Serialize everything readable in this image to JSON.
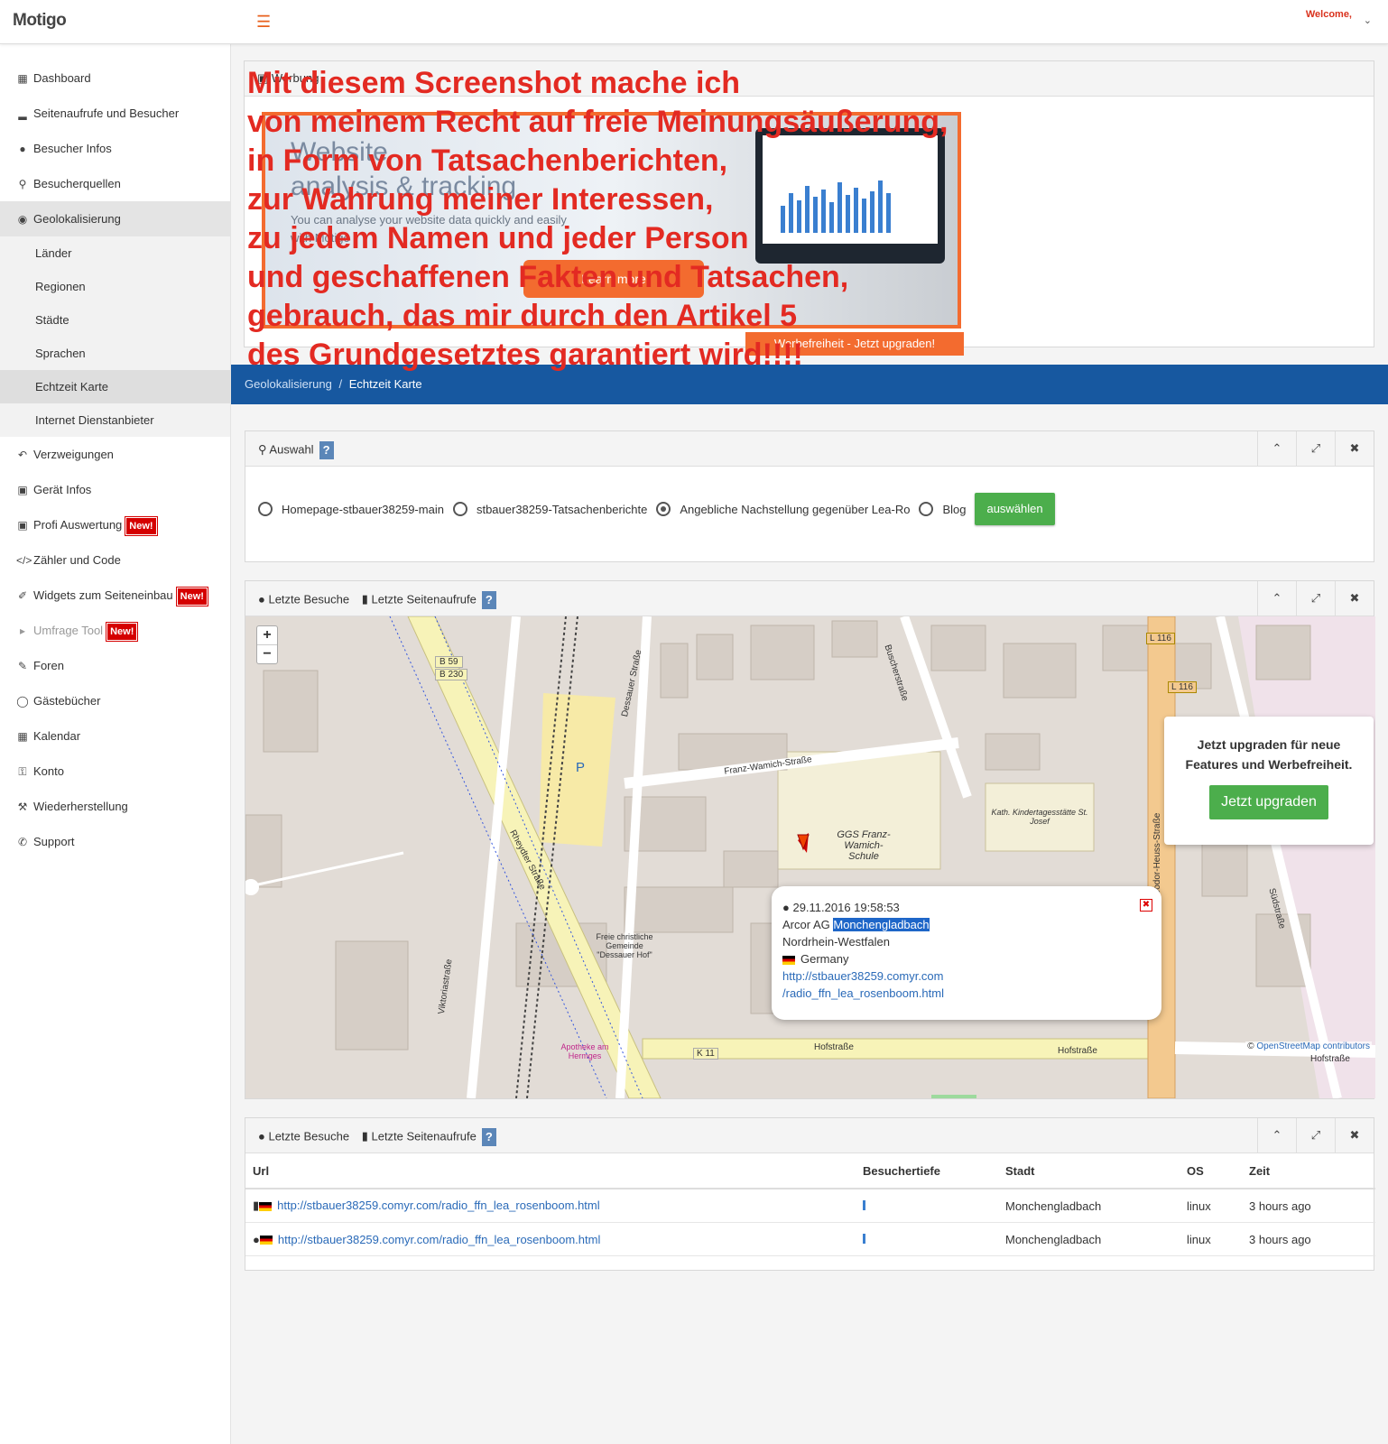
{
  "header": {
    "logo": "Motigo",
    "welcome": "Welcome,"
  },
  "sidebar": {
    "items": [
      {
        "label": "Dashboard",
        "icon": "table-icon"
      },
      {
        "label": "Seitenaufrufe und Besucher",
        "icon": "bar-chart-icon"
      },
      {
        "label": "Besucher Infos",
        "icon": "user-icon"
      },
      {
        "label": "Besucherquellen",
        "icon": "plug-icon"
      },
      {
        "label": "Geolokalisierung",
        "icon": "globe-icon"
      },
      {
        "label": "Länder"
      },
      {
        "label": "Regionen"
      },
      {
        "label": "Städte"
      },
      {
        "label": "Sprachen"
      },
      {
        "label": "Echtzeit Karte"
      },
      {
        "label": "Internet Dienstanbieter"
      },
      {
        "label": "Verzweigungen",
        "icon": "reply-icon"
      },
      {
        "label": "Gerät Infos",
        "icon": "desktop-icon"
      },
      {
        "label": "Profi Auswertung",
        "icon": "desktop-icon",
        "badge": "New!"
      },
      {
        "label": "Zähler und Code",
        "icon": "code-icon"
      },
      {
        "label": "Widgets zum Seiteneinbau",
        "icon": "paperclip-icon",
        "badge": "New!"
      },
      {
        "label": "Umfrage Tool",
        "icon": "bullhorn-icon",
        "badge": "New!"
      },
      {
        "label": "Foren",
        "icon": "edit-icon"
      },
      {
        "label": "Gästebücher",
        "icon": "comment-icon"
      },
      {
        "label": "Kalendar",
        "icon": "calendar-icon"
      },
      {
        "label": "Konto",
        "icon": "key-icon"
      },
      {
        "label": "Wiederherstellung",
        "icon": "wrench-icon"
      },
      {
        "label": "Support",
        "icon": "phone-icon"
      }
    ]
  },
  "ad": {
    "panel_title": "Werbung",
    "headline1": "Website",
    "headline2": "analysis & tracking",
    "text": "You can analyse your website data quickly and easily with Motigo",
    "button": "Learn more",
    "strip": "Werbefreiheit - Jetzt upgraden!"
  },
  "overlay_text": "Mit diesem Screenshot mache ich\nvon meinem Recht auf freie Meinungsäußerung,\nin Form von Tatsachenberichten,\nzur Wahrung meiner Interessen,\nzu jedem Namen und jeder Person\nund geschaffenen Fakten und Tatsachen,\ngebrauch, das mir durch den Artikel 5\ndes Grundgesetztes garantiert wird!!!!",
  "breadcrumb": {
    "parent": "Geolokalisierung",
    "separator": "/",
    "current": "Echtzeit Karte"
  },
  "auswahl": {
    "title": "Auswahl",
    "help": "?",
    "options": [
      {
        "label": "Homepage-stbauer38259-main",
        "checked": false
      },
      {
        "label": "stbauer38259-Tatsachenberichte",
        "checked": false
      },
      {
        "label": "Angebliche Nachstellung gegenüber Lea-Ro",
        "checked": true
      },
      {
        "label": "Blog",
        "checked": false
      }
    ],
    "button": "auswählen"
  },
  "map_panel": {
    "tab1": "Letzte Besuche",
    "tab2": "Letzte Seitenaufrufe",
    "help": "?",
    "popup": {
      "datetime": "29.11.2016 19:58:53",
      "isp": "Arcor AG",
      "city": "Monchengladbach",
      "region": "Nordrhein-Westfalen",
      "country": "Germany",
      "url_line1": "http://stbauer38259.comyr.com",
      "url_line2": "/radio_ffn_lea_rosenboom.html"
    },
    "upgrade": {
      "text": "Jetzt upgraden für neue Features und Werbefreiheit.",
      "button": "Jetzt upgraden"
    },
    "attribution_link": "OpenStreetMap",
    "attribution_rest": " contributors",
    "labels": {
      "b59": "B 59",
      "b230": "B 230",
      "dessauer": "Dessauer Straße",
      "franz": "Franz-Wamich-Straße",
      "rheydter": "Rheydter Straße",
      "buscher": "Buscherstraße",
      "school": "GGS Franz-Wamich-Schule",
      "kita": "Kath. Kindertagesstätte St. Josef",
      "church": "Freie christliche Gemeinde \"Dessauer Hof\"",
      "apotheke": "Apotheke am Hermges",
      "hofstrasse": "Hofstraße",
      "k11": "K 11",
      "l116": "L 116",
      "viktoria": "Viktoriastraße",
      "sued": "Südstraße",
      "theodor": "Theodor-Heuss-Straße",
      "parking": "P"
    }
  },
  "visits_panel": {
    "tab1": "Letzte Besuche",
    "tab2": "Letzte Seitenaufrufe",
    "help": "?",
    "columns": [
      "Url",
      "Besuchertiefe",
      "Stadt",
      "OS",
      "Zeit"
    ],
    "rows": [
      {
        "url": "http://stbauer38259.comyr.com/radio_ffn_lea_rosenboom.html",
        "city": "Monchengladbach",
        "os": "linux",
        "time": "3 hours ago",
        "icon": "file-icon"
      },
      {
        "url": "http://stbauer38259.comyr.com/radio_ffn_lea_rosenboom.html",
        "city": "Monchengladbach",
        "os": "linux",
        "time": "3 hours ago",
        "icon": "user-icon"
      }
    ]
  },
  "colors": {
    "accent": "#f36b2f",
    "breadcrumb_bg": "#1758a0",
    "green": "#4cae4c",
    "overlay_red": "#e32a22",
    "badge_red": "#d50000"
  }
}
